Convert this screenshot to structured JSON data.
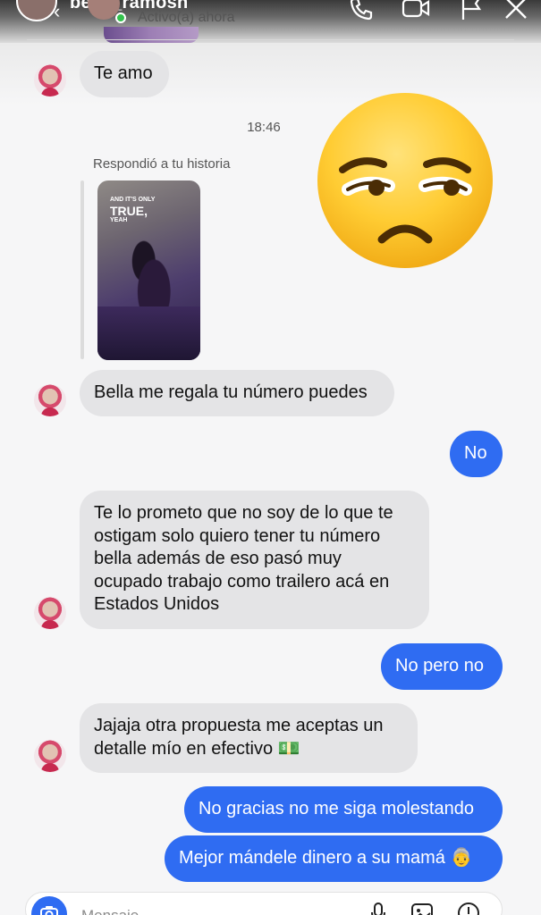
{
  "header": {
    "username": "bella_ramosh",
    "status": "Activo(a) ahora",
    "icons": [
      "back-icon",
      "phone-icon",
      "video-icon",
      "flag-icon",
      "close-icon"
    ]
  },
  "messages": {
    "m1": "Te amo",
    "timestamp": "18:46",
    "reply_label": "Respondió a tu historia",
    "story_text_small": "AND IT'S ONLY",
    "story_text_big": "TRUE,",
    "story_text_yeah": "YEAH",
    "m2": "Bella me regala tu número puedes",
    "m3": "No",
    "m4_lines": [
      "Te lo prometo que no soy de lo que te",
      "ostigam solo quiero tener tu número",
      "bella además de eso pasó muy",
      "ocupado trabajo como trailero acá en",
      "Estados Unidos"
    ],
    "m5": "No pero no",
    "m6_lines": [
      "Jajaja otra propuesta me aceptas un",
      "detalle mío en efectivo 💵"
    ],
    "m7": "No gracias no me siga molestando",
    "m8": "Mejor mándele dinero a su mamá 👵"
  },
  "overlay": {
    "emoji": "unamused-face"
  },
  "composer": {
    "placeholder": "Mensaje..."
  },
  "colors": {
    "outgoing": "#2f6cf2",
    "incoming": "#e4e4e6",
    "online": "#33c24d"
  }
}
